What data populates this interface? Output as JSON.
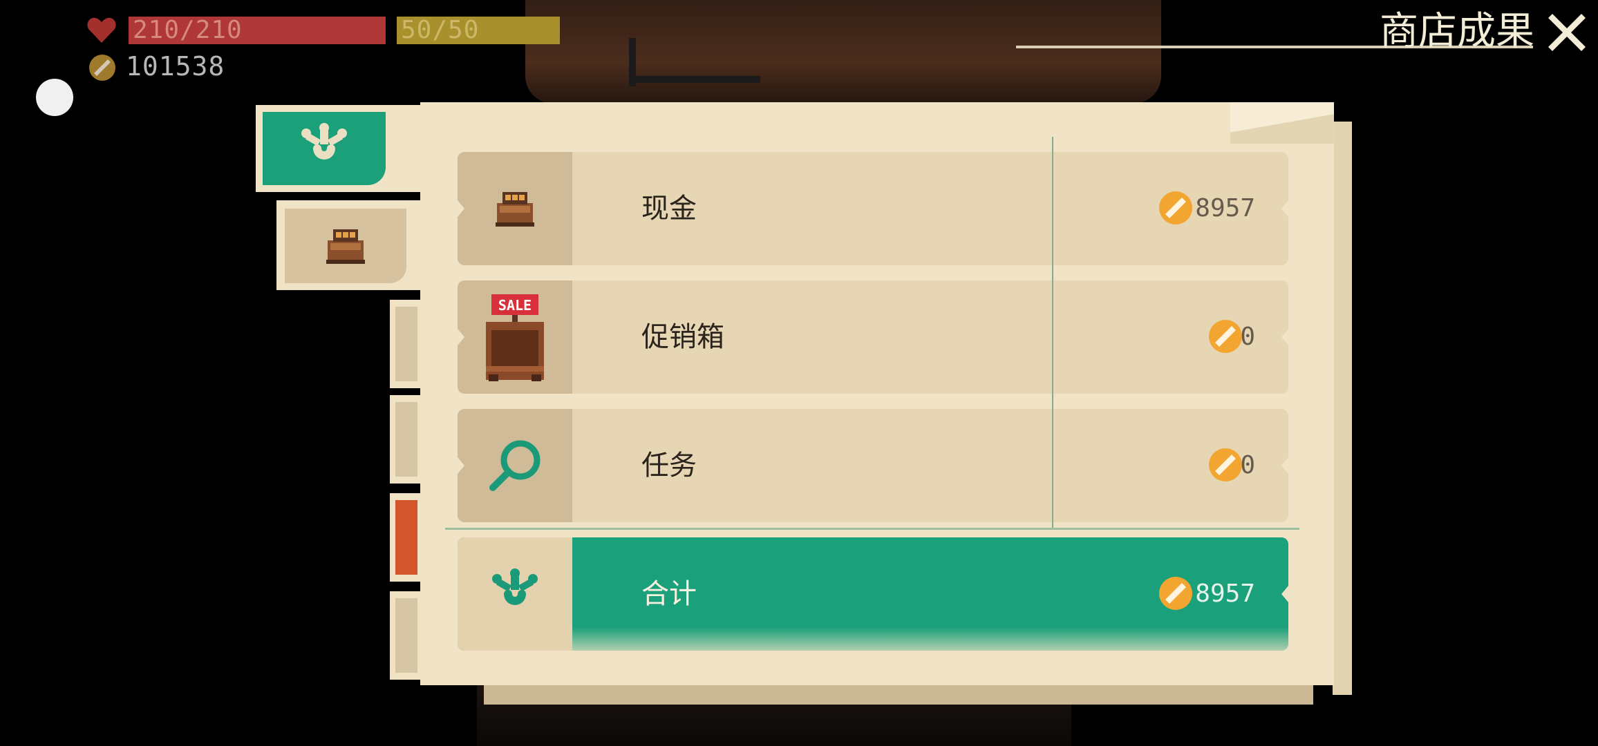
{
  "hud": {
    "hp": "210/210",
    "mp": "50/50",
    "gold": "101538"
  },
  "title": "商店成果",
  "rows": [
    {
      "label": "现金",
      "value": "8957",
      "icon": "cash-register-icon"
    },
    {
      "label": "促销箱",
      "value": "0",
      "icon": "sale-box-icon"
    },
    {
      "label": "任务",
      "value": "0",
      "icon": "magnifier-icon"
    }
  ],
  "total": {
    "label": "合计",
    "value": "8957",
    "icon": "shop-emblem-icon"
  },
  "colors": {
    "accent": "#1aa07a",
    "panel": "#f0e3c6",
    "hp": "#b03737",
    "mp": "#a8902c",
    "coin": "#f2a531"
  },
  "sale_sign": "SALE"
}
